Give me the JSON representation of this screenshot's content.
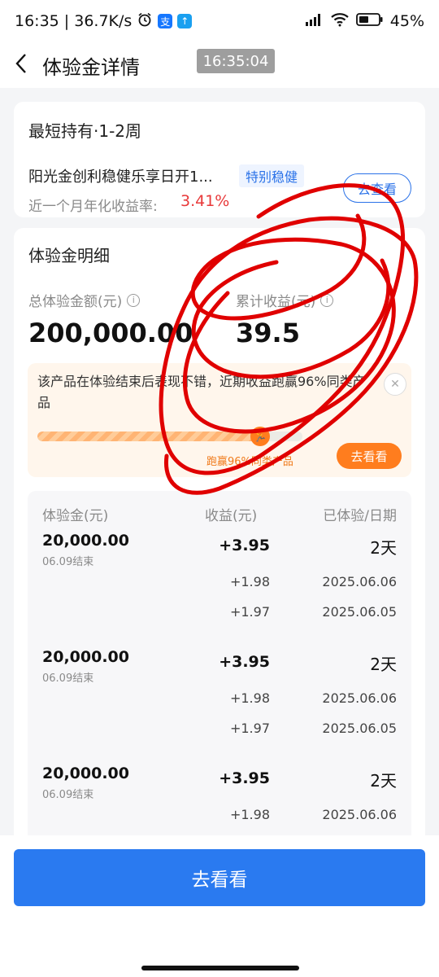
{
  "status": {
    "time_speed": "16:35 | 36.7K/s",
    "battery": "45%",
    "colors": {
      "alipay": "#1677ff",
      "upload": "#1aa0f0"
    },
    "icons": [
      "alarm-icon",
      "alipay-icon",
      "upload-icon",
      "signal-icon",
      "wifi-icon",
      "battery-icon"
    ]
  },
  "nav": {
    "title": "体验金详情",
    "time_badge": "16:35:04"
  },
  "product": {
    "title": "最短持有·1-2周",
    "name": "阳光金创利稳健乐享日开1...",
    "tag": "特别稳健",
    "rate_label": "近一个月年化收益率:",
    "rate_value": "3.41%",
    "button": "去查看"
  },
  "detail": {
    "title": "体验金明细",
    "total_label": "总体验金额(元)",
    "total_value": "200,000.00",
    "income_label": "累计收益(元)",
    "income_value": "39.5",
    "tip": {
      "text": "该产品在体验结束后表现不错，近期收益跑赢96%同类产品",
      "progress": 0.84,
      "progress_label": "跑赢96%同类产品",
      "button": "去看看"
    },
    "table": {
      "headers": {
        "amount": "体验金(元)",
        "income": "收益(元)",
        "days": "已体验/日期"
      },
      "rows": [
        {
          "amount": "20,000.00",
          "end": "06.09结束",
          "income": "+3.95",
          "days": "2天",
          "details": [
            {
              "income": "+1.98",
              "date": "2025.06.06"
            },
            {
              "income": "+1.97",
              "date": "2025.06.05"
            }
          ]
        },
        {
          "amount": "20,000.00",
          "end": "06.09结束",
          "income": "+3.95",
          "days": "2天",
          "details": [
            {
              "income": "+1.98",
              "date": "2025.06.06"
            },
            {
              "income": "+1.97",
              "date": "2025.06.05"
            }
          ]
        },
        {
          "amount": "20,000.00",
          "end": "06.09结束",
          "income": "+3.95",
          "days": "2天",
          "details": [
            {
              "income": "+1.98",
              "date": "2025.06.06"
            }
          ]
        }
      ]
    }
  },
  "cta": {
    "label": "去看看"
  },
  "colors": {
    "primary": "#2a7af0",
    "rate_red": "#e8393a",
    "orange": "#ff7d1e",
    "scribble": "#e00000"
  }
}
